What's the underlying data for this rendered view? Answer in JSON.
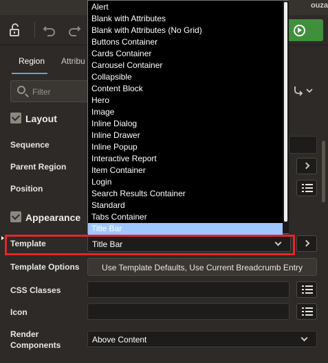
{
  "header": {
    "user_fragment": "ouza"
  },
  "tabs": [
    {
      "label": "Region"
    },
    {
      "label": "Attribu"
    }
  ],
  "filter": {
    "placeholder": "Filter"
  },
  "sections": {
    "layout": "Layout",
    "appearance": "Appearance"
  },
  "layout_fields": {
    "sequence": "Sequence",
    "parent_region": "Parent Region",
    "position": "Position"
  },
  "appearance_fields": {
    "template_label": "Template",
    "template_value": "Title Bar",
    "template_options_label": "Template Options",
    "template_options_value": "Use Template Defaults, Use Current Breadcrumb Entry",
    "css_classes_label": "CSS Classes",
    "icon_label": "Icon",
    "render_components_label_line1": "Render",
    "render_components_label_line2": "Components",
    "render_components_value": "Above Content"
  },
  "template_dropdown": {
    "options": [
      "Alert",
      "Blank with Attributes",
      "Blank with Attributes (No Grid)",
      "Buttons Container",
      "Cards Container",
      "Carousel Container",
      "Collapsible",
      "Content Block",
      "Hero",
      "Image",
      "Inline Dialog",
      "Inline Drawer",
      "Inline Popup",
      "Interactive Report",
      "Item Container",
      "Login",
      "Search Results Container",
      "Standard",
      "Tabs Container",
      "Title Bar"
    ],
    "selected": "Title Bar"
  },
  "colors": {
    "accent": "#6aa0d8",
    "run": "#3f8f3b",
    "highlight": "#e3262b",
    "selected_option": "#9fc6ff"
  }
}
